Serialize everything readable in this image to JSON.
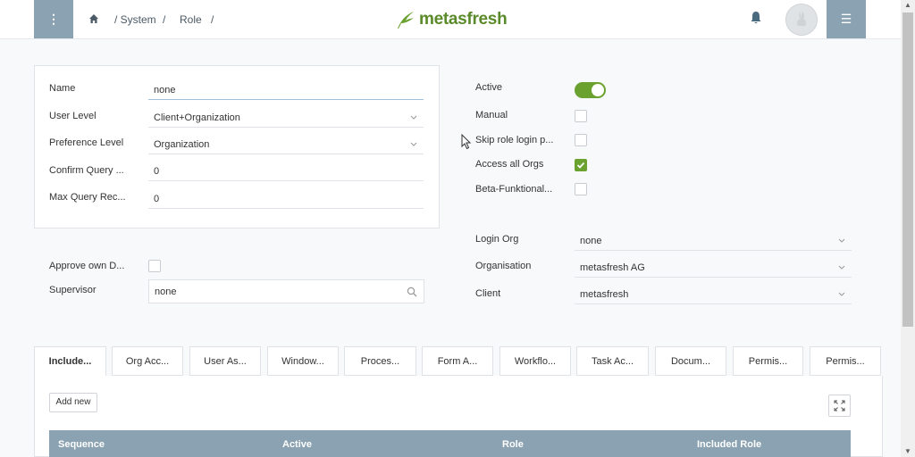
{
  "header": {
    "breadcrumb": [
      "/ System",
      "/",
      "Role",
      "/"
    ],
    "logo": "metasfresh",
    "brand_color": "#6aa12f",
    "menu_icon": "kebab-menu-icon",
    "side_icon": "list-menu-icon"
  },
  "form": {
    "name_label": "Name",
    "name_value": "none",
    "user_level_label": "User Level",
    "user_level_value": "Client+Organization",
    "preference_level_label": "Preference Level",
    "preference_level_value": "Organization",
    "confirm_query_label": "Confirm Query ...",
    "confirm_query_value": "0",
    "max_query_label": "Max Query Rec...",
    "max_query_value": "0",
    "approve_own_label": "Approve own D...",
    "supervisor_label": "Supervisor",
    "supervisor_value": "none",
    "active_label": "Active",
    "manual_label": "Manual",
    "skip_role_label": "Skip role login p...",
    "access_all_orgs_label": "Access all Orgs",
    "beta_label": "Beta-Funktional...",
    "login_org_label": "Login Org",
    "login_org_value": "none",
    "organisation_label": "Organisation",
    "organisation_value": "metasfresh AG",
    "client_label": "Client",
    "client_value": "metasfresh"
  },
  "tabs": [
    "Include...",
    "Org Acc...",
    "User As...",
    "Window...",
    "Proces...",
    "Form A...",
    "Workflo...",
    "Task Ac...",
    "Docum...",
    "Permis...",
    "Permis..."
  ],
  "grid": {
    "add_new_label": "Add new",
    "columns": [
      "Sequence",
      "Active",
      "Role",
      "Included Role"
    ]
  }
}
